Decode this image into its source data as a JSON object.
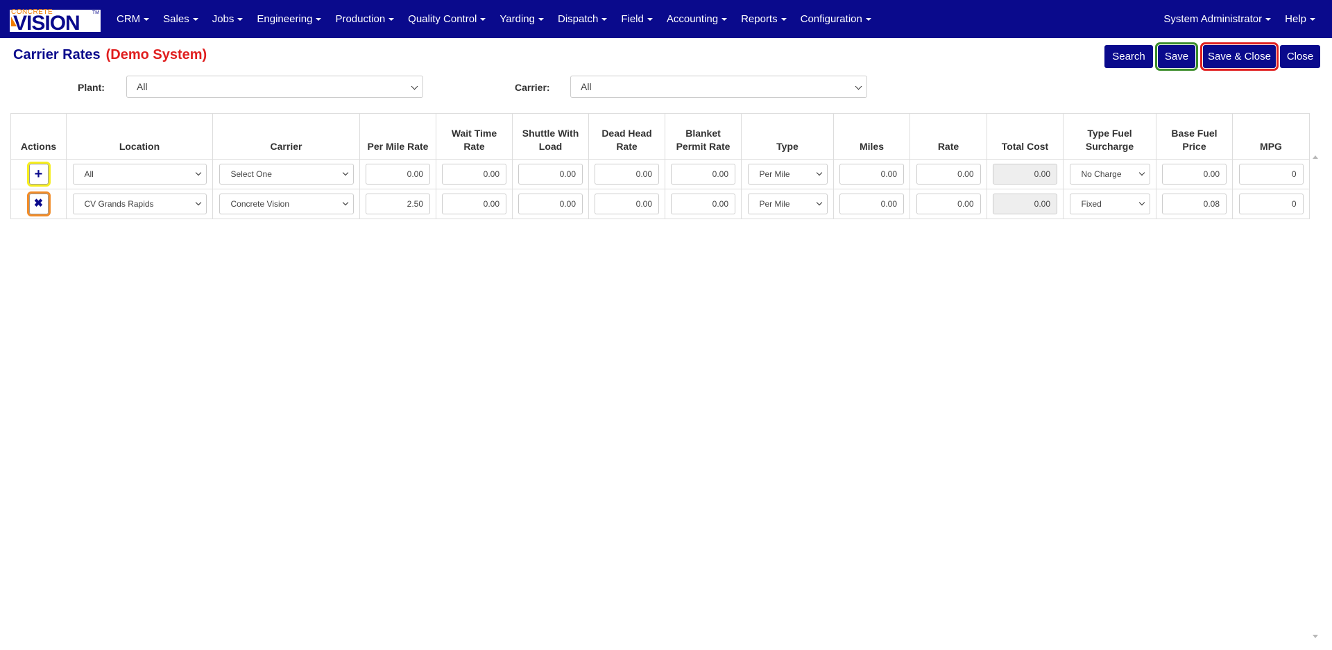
{
  "app": {
    "logo_top": "CONCRETE",
    "logo_main": "VISION",
    "logo_tm": "TM"
  },
  "nav": {
    "items": [
      "CRM",
      "Sales",
      "Jobs",
      "Engineering",
      "Production",
      "Quality Control",
      "Yarding",
      "Dispatch",
      "Field",
      "Accounting",
      "Reports",
      "Configuration"
    ],
    "user": "System Administrator",
    "help": "Help"
  },
  "page": {
    "title": "Carrier Rates",
    "demo": "(Demo System)"
  },
  "toolbar": {
    "search": "Search",
    "save": "Save",
    "save_close": "Save & Close",
    "close": "Close"
  },
  "filters": {
    "plant_label": "Plant:",
    "plant_value": "All",
    "carrier_label": "Carrier:",
    "carrier_value": "All"
  },
  "table": {
    "headers": [
      "Actions",
      "Location",
      "Carrier",
      "Per Mile Rate",
      "Wait Time Rate",
      "Shuttle With Load",
      "Dead Head Rate",
      "Blanket Permit Rate",
      "Type",
      "Miles",
      "Rate",
      "Total Cost",
      "Type Fuel Surcharge",
      "Base Fuel Price",
      "MPG"
    ],
    "rows": [
      {
        "action": "+",
        "location": "All",
        "carrier": "Select One",
        "per_mile_rate": "0.00",
        "wait_time_rate": "0.00",
        "shuttle_with_load": "0.00",
        "dead_head_rate": "0.00",
        "blanket_permit_rate": "0.00",
        "type": "Per Mile",
        "miles": "0.00",
        "rate": "0.00",
        "total_cost": "0.00",
        "type_fuel_surcharge": "No Charge",
        "base_fuel_price": "0.00",
        "mpg": "0"
      },
      {
        "action": "✖",
        "location": "CV Grands Rapids",
        "carrier": "Concrete Vision",
        "per_mile_rate": "2.50",
        "wait_time_rate": "0.00",
        "shuttle_with_load": "0.00",
        "dead_head_rate": "0.00",
        "blanket_permit_rate": "0.00",
        "type": "Per Mile",
        "miles": "0.00",
        "rate": "0.00",
        "total_cost": "0.00",
        "type_fuel_surcharge": "Fixed",
        "base_fuel_price": "0.08",
        "mpg": "0"
      }
    ]
  },
  "colors": {
    "brand_navy": "#0a0a8c",
    "demo_red": "#e01e1e",
    "logo_orange": "#f07c00",
    "save_outline": "#3b8c2a",
    "save_close_outline": "#e01e1e",
    "add_outline": "#f6ee1f",
    "remove_outline": "#f28c28"
  }
}
